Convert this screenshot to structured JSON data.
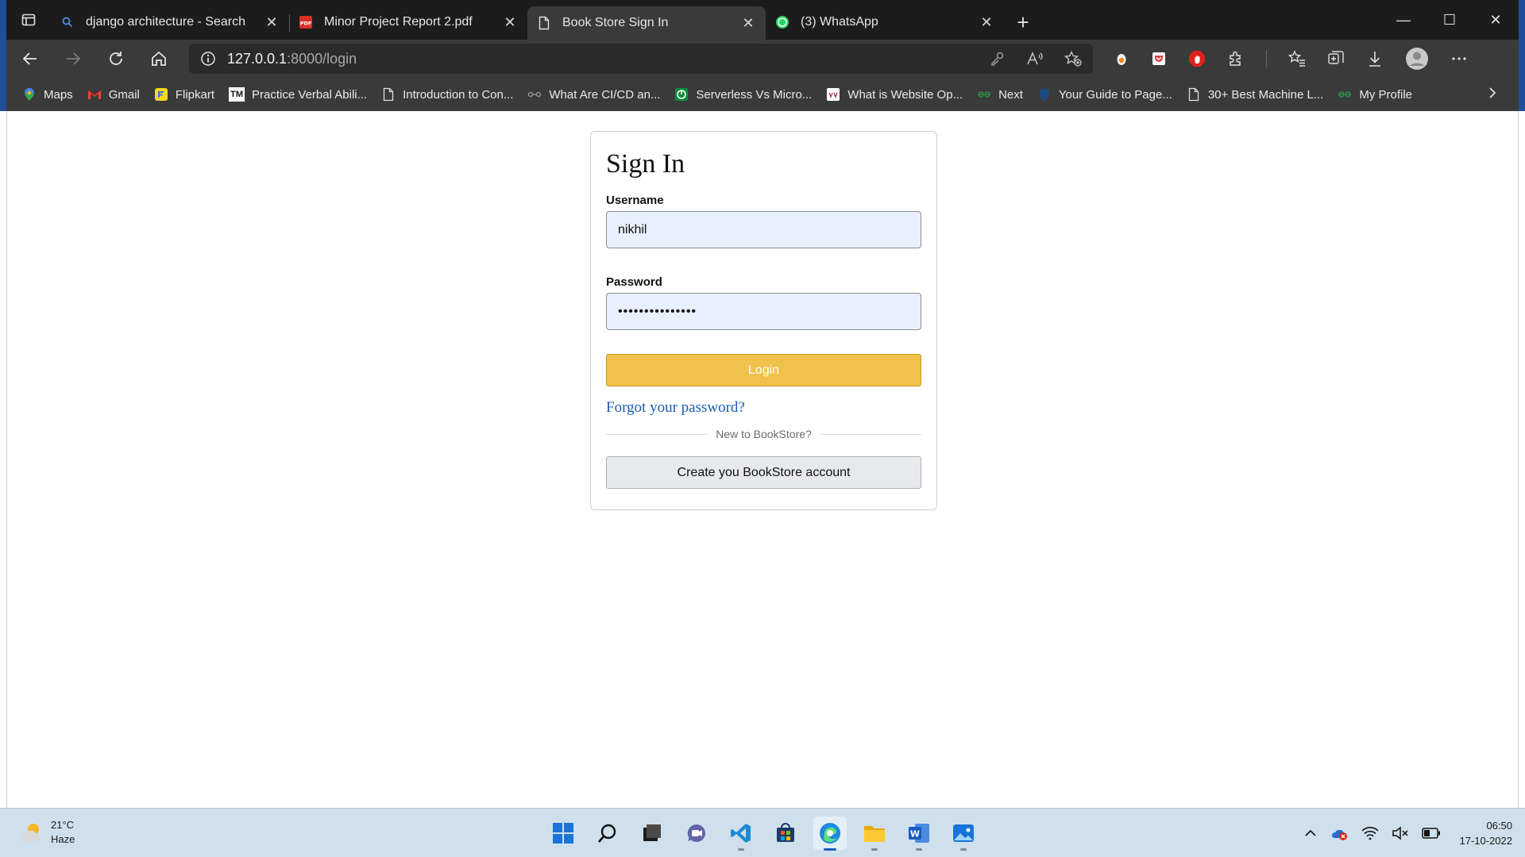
{
  "browser": {
    "tabs": [
      {
        "title": "django architecture - Search",
        "icon": "search-icon",
        "active": false
      },
      {
        "title": "Minor Project Report 2.pdf",
        "icon": "pdf-icon",
        "active": false
      },
      {
        "title": "Book Store Sign In",
        "icon": "document-icon",
        "active": true
      },
      {
        "title": "(3) WhatsApp",
        "icon": "whatsapp-icon",
        "active": false
      }
    ],
    "close_glyph": "✕",
    "new_tab_glyph": "+",
    "address": {
      "host": "127.0.0.1",
      "path": ":8000/login"
    },
    "bookmarks": [
      {
        "label": "Maps",
        "icon": "maps-icon"
      },
      {
        "label": "Gmail",
        "icon": "gmail-icon"
      },
      {
        "label": "Flipkart",
        "icon": "flipkart-icon"
      },
      {
        "label": "Practice Verbal Abili...",
        "icon": "tm-icon",
        "icon_text": "TM"
      },
      {
        "label": "Introduction to Con...",
        "icon": "document-icon"
      },
      {
        "label": "What Are CI/CD an...",
        "icon": "cicd-icon"
      },
      {
        "label": "Serverless Vs Micro...",
        "icon": "serverless-icon"
      },
      {
        "label": "What is Website Op...",
        "icon": "website-icon"
      },
      {
        "label": "Next",
        "icon": "gfg-icon"
      },
      {
        "label": "Your Guide to Page...",
        "icon": "shield-icon"
      },
      {
        "label": "30+ Best Machine L...",
        "icon": "document-icon"
      },
      {
        "label": "My Profile",
        "icon": "gfg-icon"
      }
    ]
  },
  "signin": {
    "title": "Sign In",
    "username_label": "Username",
    "username_value": "nikhil",
    "password_label": "Password",
    "password_value": "•••••••••••••••",
    "login_label": "Login",
    "forgot_label": "Forgot your password?",
    "divider_text": "New to BookStore?",
    "create_label": "Create you BookStore account"
  },
  "taskbar": {
    "temperature": "21°C",
    "condition": "Haze",
    "time": "06:50",
    "date": "17-10-2022"
  },
  "colors": {
    "login_button": "#f0c14b",
    "link": "#1a5cb5",
    "input_fill": "#e8f0fe"
  }
}
